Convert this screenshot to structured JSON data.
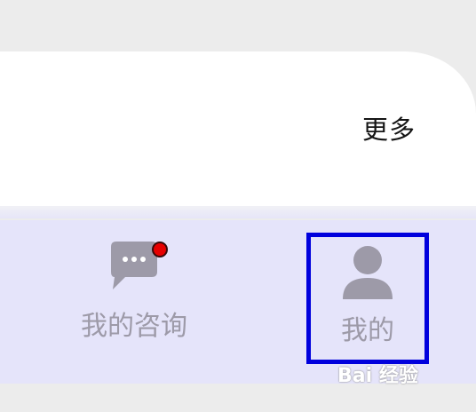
{
  "header_panel": {
    "more_label": "更多"
  },
  "tabbar": {
    "tabs": [
      {
        "label": "我的咨询",
        "icon": "chat-bubble-icon",
        "has_badge": true
      },
      {
        "label": "我的",
        "icon": "person-icon",
        "selected": true
      }
    ]
  },
  "watermark": {
    "text": "Bai 经验"
  },
  "colors": {
    "tab_bar_background": "#e5e4fa",
    "icon_color": "#9d9aa8",
    "badge_color": "#e60000",
    "highlight_border": "#0000dd"
  }
}
